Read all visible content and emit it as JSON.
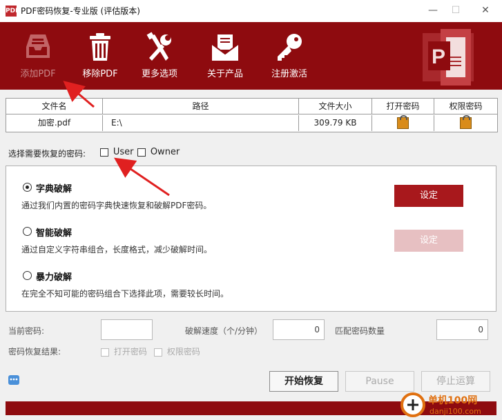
{
  "window": {
    "app_icon": "PDF",
    "title": "PDF密码恢复-专业版 (评估版本)",
    "minimize": "—",
    "maximize": "☐",
    "close": "✕"
  },
  "toolbar": {
    "items": [
      {
        "label": "添加PDF",
        "icon": "inbox-tray-icon",
        "disabled": true
      },
      {
        "label": "移除PDF",
        "icon": "trash-icon"
      },
      {
        "label": "更多选项",
        "icon": "tools-icon"
      },
      {
        "label": "关于产品",
        "icon": "envelope-icon"
      },
      {
        "label": "注册激活",
        "icon": "key-icon"
      }
    ],
    "colors": {
      "bg": "#8e0b0f"
    }
  },
  "file_table": {
    "headers": [
      "文件名",
      "路径",
      "文件大小",
      "打开密码",
      "权限密码"
    ],
    "rows": [
      {
        "name": "加密.pdf",
        "path": "E:\\",
        "size": "309.79 KB",
        "open_pw": "lock-icon",
        "perm_pw": "lock-icon"
      }
    ]
  },
  "password_select": {
    "label": "选择需要恢复的密码:",
    "user": "User",
    "owner": "Owner"
  },
  "options": [
    {
      "title": "字典破解",
      "desc": "通过我们内置的密码字典快速恢复和破解PDF密码。",
      "selected": true,
      "button": "设定"
    },
    {
      "title": "智能破解",
      "desc": "通过自定义字符串组合，长度格式，减少破解时间。",
      "selected": false,
      "button": "设定"
    },
    {
      "title": "暴力破解",
      "desc": "在完全不知可能的密码组合下选择此项，需要较长时间。",
      "selected": false
    }
  ],
  "status": {
    "current_pw_label": "当前密码:",
    "current_pw_value": "",
    "speed_label": "破解速度（个/分钟）",
    "speed_value": "0",
    "match_label": "匹配密码数量",
    "match_value": "0",
    "result_label": "密码恢复结果:",
    "result_open": "打开密码",
    "result_perm": "权限密码"
  },
  "actions": {
    "start": "开始恢复",
    "pause": "Pause",
    "stop": "停止运算"
  },
  "watermark": {
    "text_cn": "单机100网",
    "text_url": "danji100.com"
  }
}
